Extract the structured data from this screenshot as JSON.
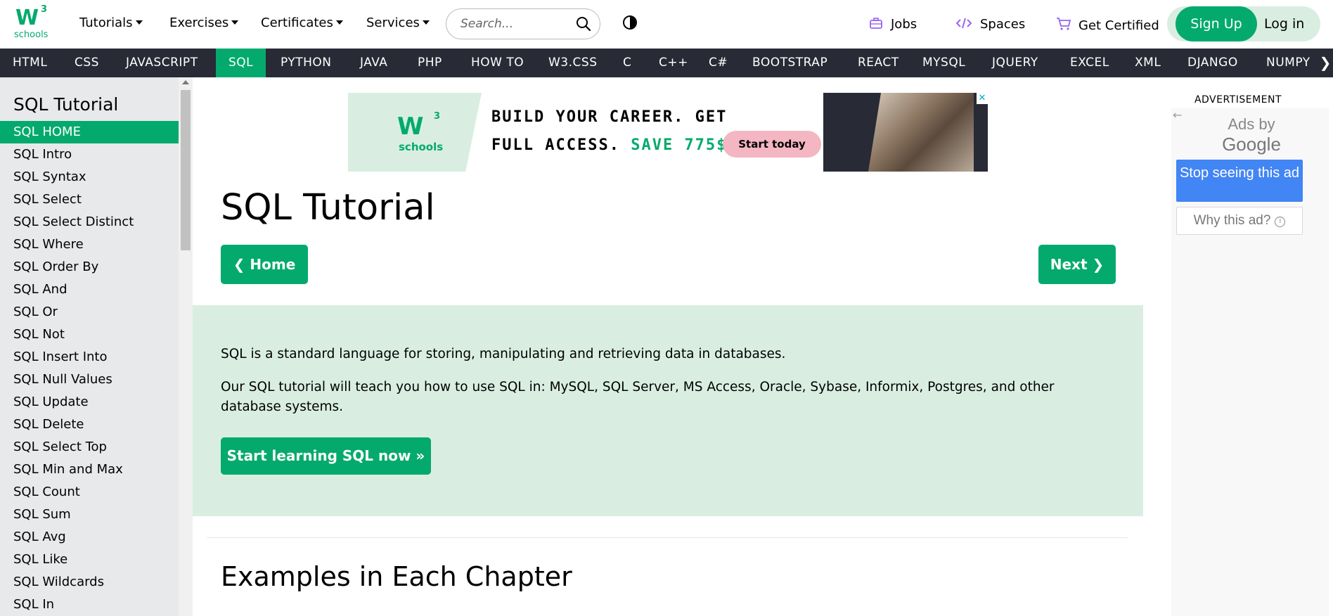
{
  "header": {
    "logo": {
      "main": "W",
      "sup": "3",
      "sub": "schools"
    },
    "nav": [
      {
        "label": "Tutorials"
      },
      {
        "label": "Exercises"
      },
      {
        "label": "Certificates"
      },
      {
        "label": "Services"
      }
    ],
    "search": {
      "placeholder": "Search...",
      "value": ""
    },
    "links": [
      {
        "label": "Jobs",
        "icon": "briefcase-icon"
      },
      {
        "label": "Spaces",
        "icon": "code-icon"
      },
      {
        "label": "Get Certified",
        "icon": "cart-icon"
      }
    ],
    "signup_label": "Sign Up",
    "login_label": "Log in"
  },
  "langbar": {
    "items": [
      "HTML",
      "CSS",
      "JAVASCRIPT",
      "SQL",
      "PYTHON",
      "JAVA",
      "PHP",
      "HOW TO",
      "W3.CSS",
      "C",
      "C++",
      "C#",
      "BOOTSTRAP",
      "REACT",
      "MYSQL",
      "JQUERY",
      "EXCEL",
      "XML",
      "DJANGO",
      "NUMPY"
    ],
    "active": "SQL",
    "arrow": "❯"
  },
  "sidebar": {
    "title": "SQL Tutorial",
    "items": [
      "SQL HOME",
      "SQL Intro",
      "SQL Syntax",
      "SQL Select",
      "SQL Select Distinct",
      "SQL Where",
      "SQL Order By",
      "SQL And",
      "SQL Or",
      "SQL Not",
      "SQL Insert Into",
      "SQL Null Values",
      "SQL Update",
      "SQL Delete",
      "SQL Select Top",
      "SQL Min and Max",
      "SQL Count",
      "SQL Sum",
      "SQL Avg",
      "SQL Like",
      "SQL Wildcards",
      "SQL In"
    ],
    "active": "SQL HOME"
  },
  "banner": {
    "logo_main": "W",
    "logo_sup": "3",
    "logo_sub": "schools",
    "line1": "BUILD YOUR CAREER. GET",
    "line2": "FULL ACCESS.",
    "save": "SAVE 775$",
    "cta": "Start today",
    "close": "✕"
  },
  "main": {
    "title": "SQL Tutorial",
    "home_label": "❮ Home",
    "next_label": "Next ❯",
    "intro_p1": "SQL is a standard language for storing, manipulating and retrieving data in databases.",
    "intro_p2": "Our SQL tutorial will teach you how to use SQL in: MySQL, SQL Server, MS Access, Oracle, Sybase, Informix, Postgres, and other database systems.",
    "start_label": "Start learning SQL now »",
    "section_title": "Examples in Each Chapter"
  },
  "ad": {
    "label": "ADVERTISEMENT",
    "back": "←",
    "ads_by": "Ads by",
    "google": "Google",
    "stop": "Stop seeing this ad",
    "why": "Why this ad?",
    "info": "i"
  },
  "colors": {
    "accent": "#04AA6D",
    "dark_bar": "#282A35",
    "light_green": "#D9EEE1",
    "sidebar_bg": "#E7E9EB",
    "icon_purple": "#9763f6",
    "google_blue": "#4285F4"
  }
}
